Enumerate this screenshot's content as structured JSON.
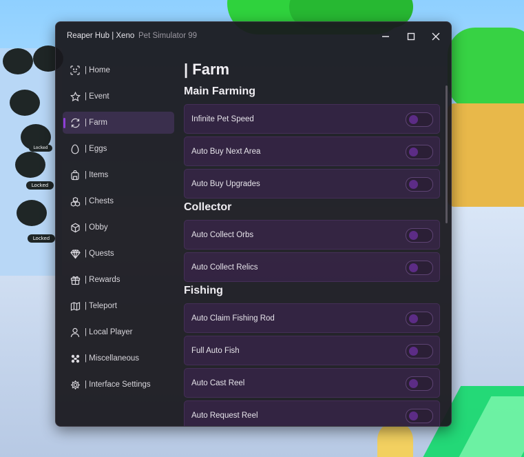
{
  "window": {
    "title": "Reaper Hub | Xeno",
    "subtitle": "Pet Simulator 99"
  },
  "sidebar": {
    "items": [
      {
        "label": "| Home",
        "icon": "scan-face-icon",
        "active": false
      },
      {
        "label": "| Event",
        "icon": "star-icon",
        "active": false
      },
      {
        "label": "| Farm",
        "icon": "refresh-icon",
        "active": true
      },
      {
        "label": "| Eggs",
        "icon": "egg-icon",
        "active": false
      },
      {
        "label": "| Items",
        "icon": "backpack-icon",
        "active": false
      },
      {
        "label": "| Chests",
        "icon": "boxes-icon",
        "active": false
      },
      {
        "label": "| Obby",
        "icon": "cube-icon",
        "active": false
      },
      {
        "label": "| Quests",
        "icon": "gem-icon",
        "active": false
      },
      {
        "label": "| Rewards",
        "icon": "gift-icon",
        "active": false
      },
      {
        "label": "| Teleport",
        "icon": "map-icon",
        "active": false
      },
      {
        "label": "| Local Player",
        "icon": "user-icon",
        "active": false
      },
      {
        "label": "| Miscellaneous",
        "icon": "puzzle-icon",
        "active": false
      },
      {
        "label": "| Interface Settings",
        "icon": "settings-cog-icon",
        "active": false
      }
    ]
  },
  "page": {
    "title": "| Farm",
    "sections": [
      {
        "title": "Main Farming",
        "toggles": [
          "Infinite Pet Speed",
          "Auto Buy Next Area",
          "Auto Buy Upgrades"
        ]
      },
      {
        "title": "Collector",
        "toggles": [
          "Auto Collect Orbs",
          "Auto Collect Relics"
        ]
      },
      {
        "title": "Fishing",
        "toggles": [
          "Auto Claim Fishing Rod",
          "Full Auto Fish",
          "Auto Cast Reel",
          "Auto Request Reel"
        ]
      }
    ]
  },
  "background": {
    "badges": [
      "Locked",
      "Locked",
      "Locked"
    ]
  },
  "colors": {
    "accent": "#8d3fd6",
    "window_bg": "#1a181e",
    "toggle_row_bg": "#46265f",
    "toggle_knob_off": "#5c2c86"
  }
}
